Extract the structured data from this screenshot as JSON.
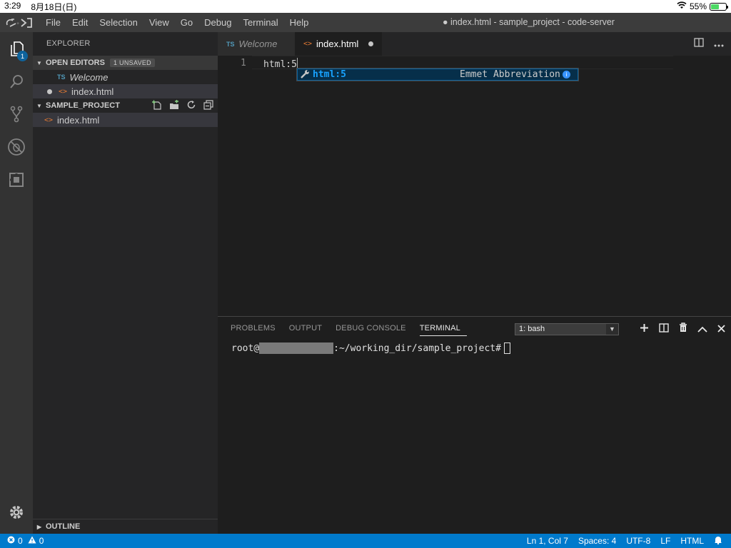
{
  "ios_status": {
    "time": "3:29",
    "date": "8月18日(日)",
    "battery": "55%",
    "battery_level": 0.55
  },
  "titlebar": {
    "menu": [
      "File",
      "Edit",
      "Selection",
      "View",
      "Go",
      "Debug",
      "Terminal",
      "Help"
    ],
    "window_title": "● index.html - sample_project - code-server"
  },
  "activitybar": {
    "explorer_badge": "1"
  },
  "sidebar": {
    "header": "EXPLORER",
    "open_editors": {
      "title": "OPEN EDITORS",
      "badge": "1 UNSAVED",
      "items": [
        {
          "icon": "TS",
          "label": "Welcome"
        },
        {
          "icon": "<>",
          "label": "index.html"
        }
      ]
    },
    "project": {
      "title": "SAMPLE_PROJECT",
      "items": [
        {
          "icon": "<>",
          "label": "index.html"
        }
      ]
    },
    "outline_title": "OUTLINE"
  },
  "editor": {
    "tabs": [
      {
        "icon": "TS",
        "label": "Welcome"
      },
      {
        "icon": "<>",
        "label": "index.html"
      }
    ],
    "line_number": "1",
    "code": "html:5",
    "suggest": {
      "label": "html:5",
      "detail": "Emmet Abbreviation"
    }
  },
  "panel": {
    "tabs": [
      "PROBLEMS",
      "OUTPUT",
      "DEBUG CONSOLE",
      "TERMINAL"
    ],
    "terminal_select": "1: bash",
    "prompt_user": "root@",
    "prompt_path": ":~/working_dir/sample_project#"
  },
  "statusbar": {
    "errors": "0",
    "warnings": "0",
    "position": "Ln 1, Col 7",
    "spaces": "Spaces: 4",
    "encoding": "UTF-8",
    "eol": "LF",
    "language": "HTML"
  },
  "colors": {
    "accent": "#007acc",
    "html_icon": "#e37933",
    "ts_icon": "#519aba",
    "suggest_highlight": "#18a3ff"
  }
}
